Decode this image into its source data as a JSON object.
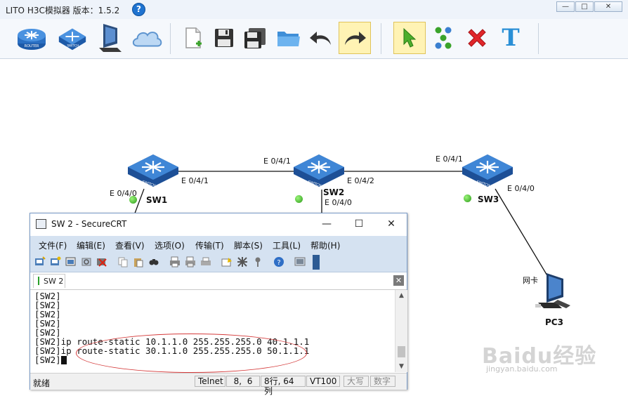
{
  "app": {
    "title": "LITO H3C模拟器 版本：1.5.2",
    "help_glyph": "?",
    "window_buttons": [
      "—",
      "□",
      "✕"
    ]
  },
  "toolbar": {
    "items": [
      {
        "name": "router-tool",
        "icon": "router-icon"
      },
      {
        "name": "switch-tool",
        "icon": "switch-icon"
      },
      {
        "name": "pc-tool",
        "icon": "pc-icon"
      },
      {
        "name": "cloud-tool",
        "icon": "cloud-icon"
      },
      {
        "name": "new-file",
        "icon": "new-file-icon"
      },
      {
        "name": "save",
        "icon": "save-icon"
      },
      {
        "name": "save-as",
        "icon": "save-as-icon"
      },
      {
        "name": "open",
        "icon": "folder-icon"
      },
      {
        "name": "undo",
        "icon": "undo-icon"
      },
      {
        "name": "redo",
        "icon": "redo-icon"
      },
      {
        "name": "select",
        "icon": "pointer-icon"
      },
      {
        "name": "connect",
        "icon": "link-icon"
      },
      {
        "name": "delete",
        "icon": "delete-icon"
      },
      {
        "name": "text",
        "icon": "text-icon",
        "glyph": "T"
      }
    ],
    "router_badge": "ROUTER",
    "switch_badge": "SWITCH"
  },
  "topology": {
    "nodes": {
      "sw1": {
        "label": "SW1",
        "badge": "SWITCH"
      },
      "sw2": {
        "label": "SW2",
        "badge": "SWITCH"
      },
      "sw3": {
        "label": "SW3",
        "badge": "SWITCH"
      },
      "pc3": {
        "label": "PC3",
        "nic": "网卡"
      }
    },
    "ports": {
      "sw1_e040": "E 0/4/0",
      "sw1_e041": "E 0/4/1",
      "sw2_e041": "E 0/4/1",
      "sw2_e042": "E 0/4/2",
      "sw2_e040": "E 0/4/0",
      "sw3_e041": "E 0/4/1",
      "sw3_e040": "E 0/4/0"
    },
    "status_color": "#2b9a18"
  },
  "crt": {
    "title": "SW 2 - SecureCRT",
    "window_buttons": [
      "—",
      "☐",
      "✕"
    ],
    "menu": [
      "文件(F)",
      "编辑(E)",
      "查看(V)",
      "选项(O)",
      "传输(T)",
      "脚本(S)",
      "工具(L)",
      "帮助(H)"
    ],
    "tab": "SW 2",
    "tab_close": "✕",
    "terminal_lines": [
      "[SW2]",
      "[SW2]",
      "[SW2]",
      "[SW2]",
      "[SW2]",
      "[SW2]ip route-static 10.1.1.0 255.255.255.0 40.1.1.1",
      "[SW2]ip route-static 30.1.1.0 255.255.255.0 50.1.1.1",
      "[SW2]"
    ],
    "status": {
      "ready": "就绪",
      "protocol": "Telnet",
      "position": "8,  6",
      "rows_cols": "8行, 64列",
      "terminal": "VT100",
      "caps": "大写",
      "num": "数字"
    }
  },
  "watermark": {
    "text": "Baidu经验",
    "url": "jingyan.baidu.com"
  }
}
